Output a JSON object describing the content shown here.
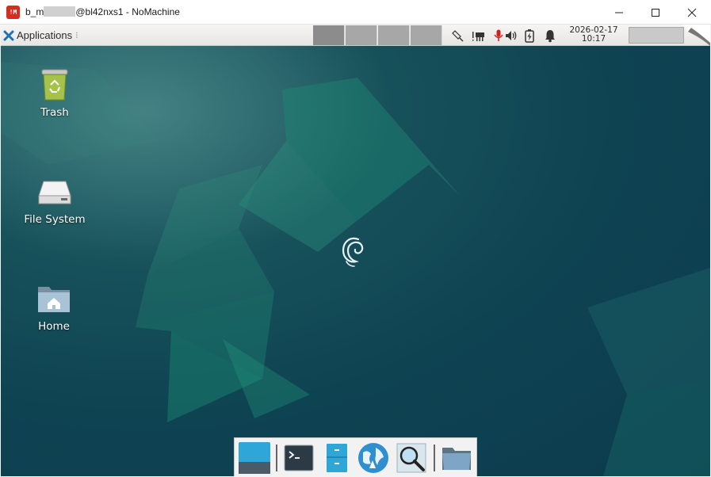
{
  "window": {
    "logo_text": "!M",
    "title_prefix": "b_m",
    "title_suffix": "@bl42nxs1 - NoMachine",
    "controls": {
      "minimize": "minimize-icon",
      "maximize": "maximize-icon",
      "close": "close-icon"
    }
  },
  "panel": {
    "applications_label": "Applications",
    "applications_suffix": "⁝",
    "workspaces": 4,
    "active_workspace": 1,
    "tray_icons": [
      "network-icon",
      "devices-icon",
      "microphone-icon",
      "volume-icon",
      "battery-icon",
      "notification-bell-icon"
    ],
    "clock": {
      "date": "2026-02-17",
      "time": "10:17"
    }
  },
  "desktop": {
    "icons": [
      {
        "label": "Trash",
        "icon": "trash-icon"
      },
      {
        "label": "File System",
        "icon": "drive-icon"
      },
      {
        "label": "Home",
        "icon": "home-folder-icon"
      }
    ],
    "center_logo": "debian-swirl-icon"
  },
  "dock": {
    "items": [
      "show-desktop-icon",
      "terminal-icon",
      "file-manager-icon",
      "web-browser-icon",
      "app-finder-icon",
      "folder-icon"
    ]
  },
  "colors": {
    "window_close_accent": "#d62d20",
    "desktop_base": "#0c3b4d",
    "desktop_accent": "#1a8a78",
    "mic_red": "#d01f1f"
  }
}
